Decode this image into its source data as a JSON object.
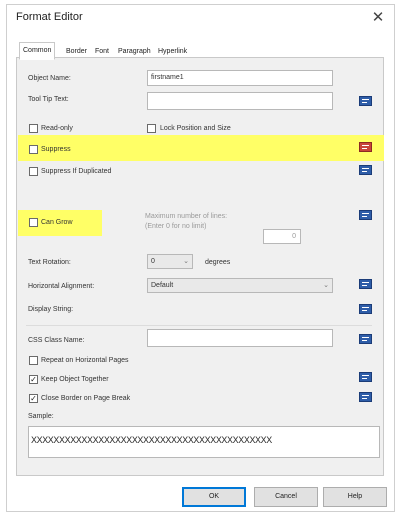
{
  "window": {
    "title": "Format Editor",
    "close_glyph": "✕"
  },
  "tabs": [
    {
      "label": "Common"
    },
    {
      "label": "Border"
    },
    {
      "label": "Font"
    },
    {
      "label": "Paragraph"
    },
    {
      "label": "Hyperlink"
    }
  ],
  "fields": {
    "object_name_label": "Object Name:",
    "object_name_value": "firstname1",
    "tooltip_label": "Tool Tip Text:",
    "tooltip_value": "",
    "css_label": "CSS Class Name:",
    "css_value": "",
    "text_rotation_label": "Text Rotation:",
    "text_rotation_value": "0",
    "degrees_label": "degrees",
    "horizontal_alignment_label": "Horizontal Alignment:",
    "horizontal_alignment_value": "Default",
    "display_string_label": "Display String:",
    "max_lines_label_1": "Maximum number of lines:",
    "max_lines_label_2": "(Enter 0 for no limit)",
    "max_lines_value": "0",
    "sample_label": "Sample:",
    "sample_value": "XXXXXXXXXXXXXXXXXXXXXXXXXXXXXXXXXXXXXXXXXXX"
  },
  "checkboxes": {
    "read_only": {
      "label": "Read-only",
      "checked": false
    },
    "lock_position": {
      "label": "Lock Position and Size",
      "checked": false
    },
    "suppress": {
      "label": "Suppress",
      "checked": false
    },
    "suppress_duplicated": {
      "label": "Suppress If Duplicated",
      "checked": false
    },
    "can_grow": {
      "label": "Can Grow",
      "checked": false
    },
    "repeat_horizontal": {
      "label": "Repeat on Horizontal Pages",
      "checked": false
    },
    "keep_together": {
      "label": "Keep Object Together",
      "checked": true,
      "glyph": "✓"
    },
    "close_border": {
      "label": "Close Border on Page Break",
      "checked": true,
      "glyph": "✓"
    }
  },
  "formula_icon": {
    "name": "formula-editor-icon",
    "color": "#2e5da8",
    "active_color": "#c9453a"
  },
  "highlight_color": "#ffff66",
  "buttons": {
    "ok": "OK",
    "cancel": "Cancel",
    "help": "Help"
  }
}
